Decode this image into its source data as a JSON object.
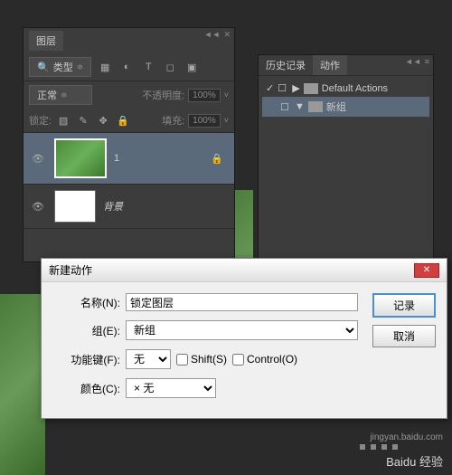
{
  "layers_panel": {
    "title": "图层",
    "filter_label": "类型",
    "blend_mode": "正常",
    "opacity_label": "不透明度:",
    "opacity_value": "100%",
    "lock_label": "锁定:",
    "fill_label": "填充:",
    "fill_value": "100%",
    "layers": [
      {
        "name": "1",
        "selected": true,
        "locked": true,
        "thumb": "green"
      },
      {
        "name": "背景",
        "selected": false,
        "locked": false,
        "thumb": "white"
      }
    ]
  },
  "history_panel": {
    "tab1": "历史记录",
    "tab2": "动作",
    "items": [
      {
        "name": "Default Actions",
        "checked": true,
        "expanded": false
      },
      {
        "name": "新组",
        "checked": false,
        "expanded": true,
        "selected": true
      }
    ]
  },
  "dialog": {
    "title": "新建动作",
    "name_label": "名称(N):",
    "name_value": "锁定图层",
    "group_label": "组(E):",
    "group_value": "新组",
    "fnkey_label": "功能键(F):",
    "fnkey_value": "无",
    "shift_label": "Shift(S)",
    "control_label": "Control(O)",
    "color_label": "颜色(C):",
    "color_value": "无",
    "record_btn": "记录",
    "cancel_btn": "取消"
  },
  "watermark": "Baidu 经验",
  "watermark_url": "jingyan.baidu.com"
}
